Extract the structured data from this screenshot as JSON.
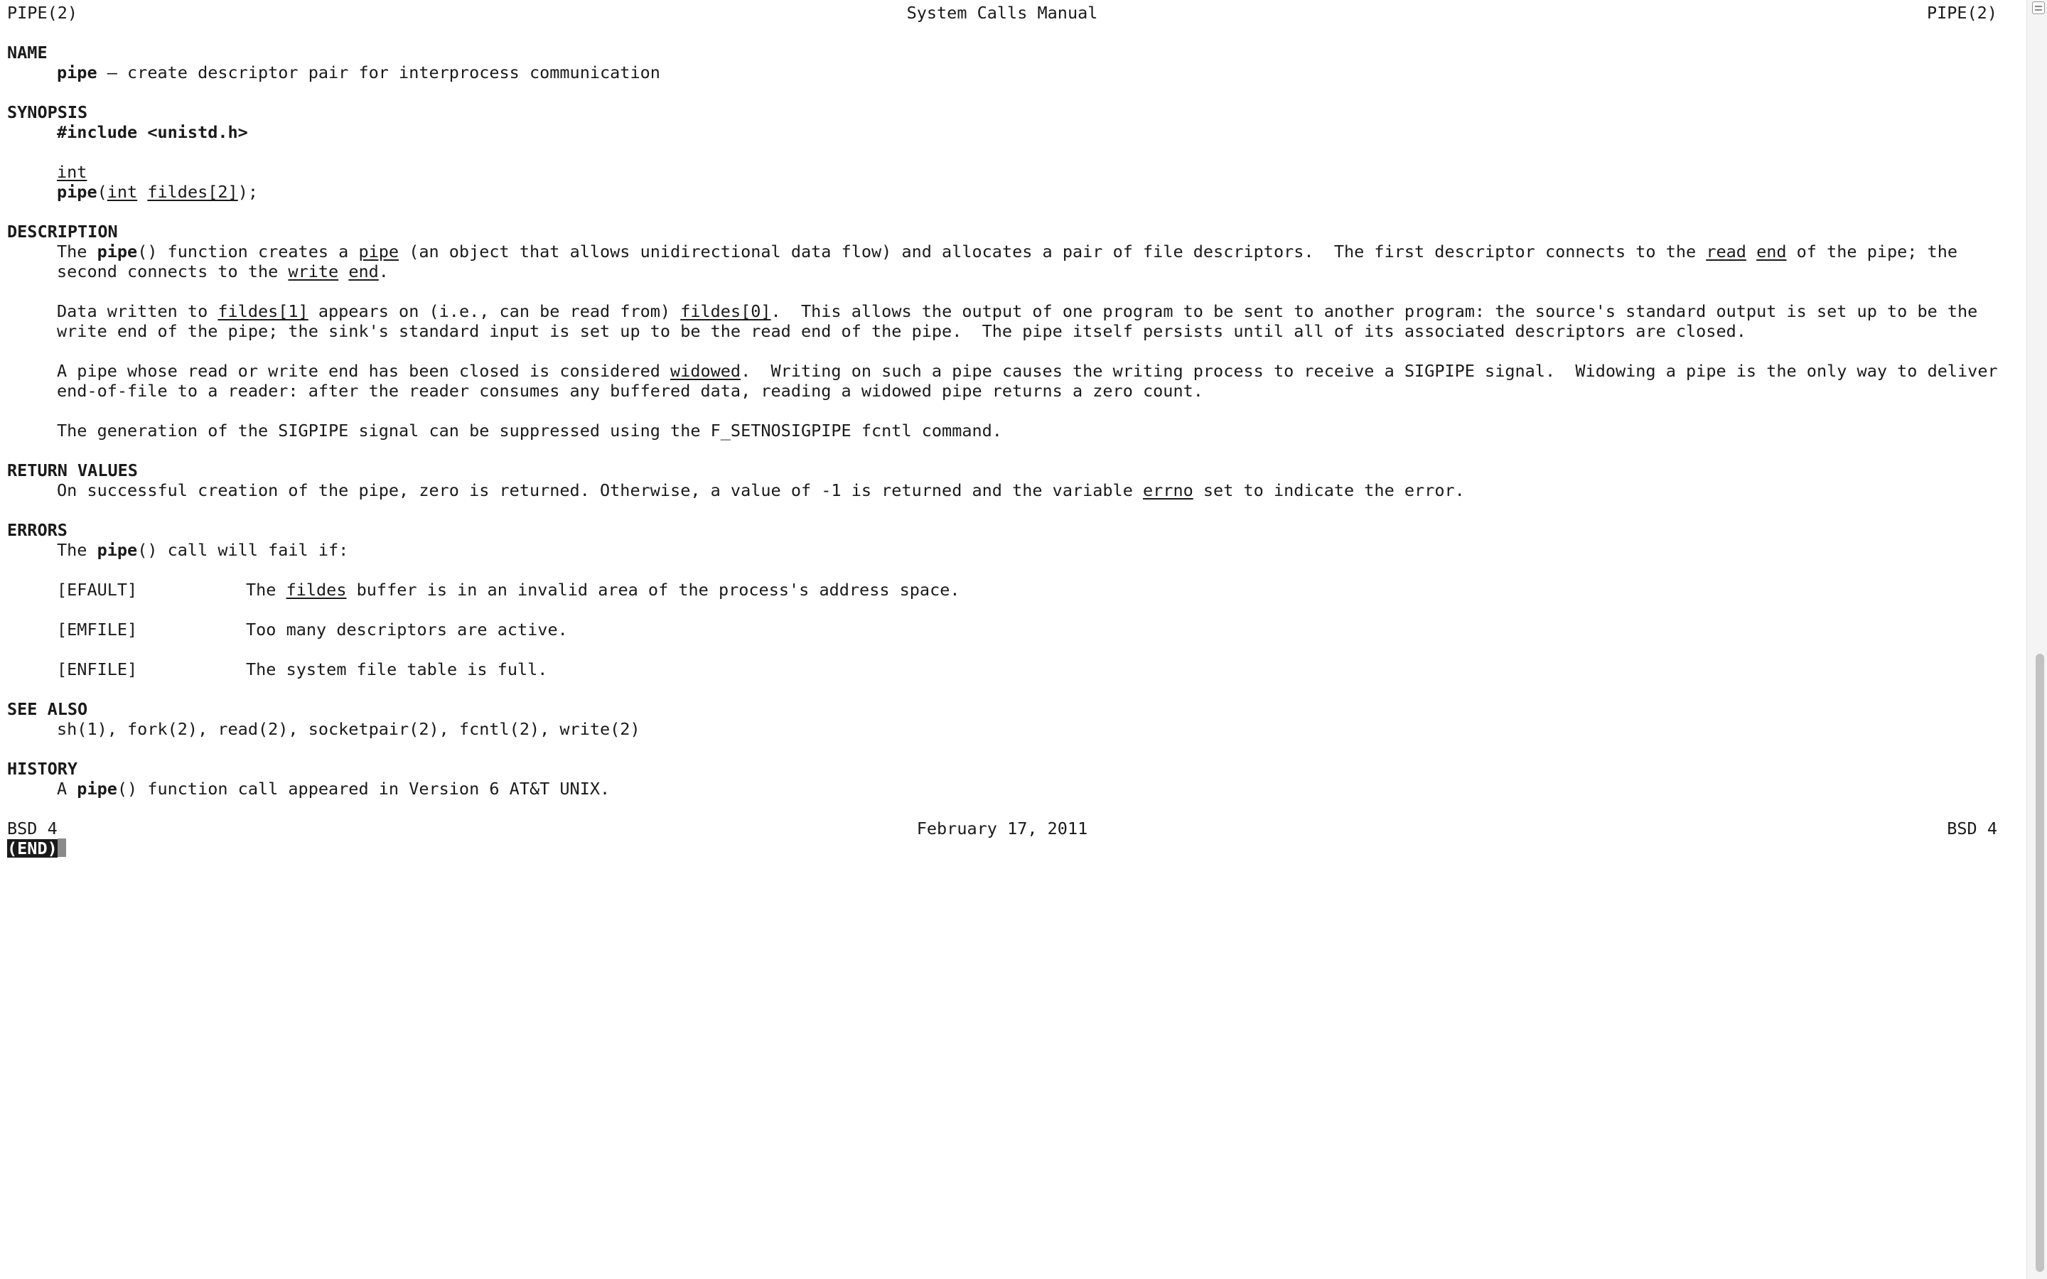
{
  "header": {
    "left": "PIPE(2)",
    "center": "System Calls Manual",
    "right": "PIPE(2)"
  },
  "name": {
    "heading": "NAME",
    "cmd": "pipe",
    "desc": " – create descriptor pair for interprocess communication"
  },
  "synopsis": {
    "heading": "SYNOPSIS",
    "include": "#include <unistd.h>",
    "ret_type": "int",
    "fn": "pipe",
    "open": "(",
    "arg_type": "int",
    "arg_name": "fildes[2]",
    "close": ");"
  },
  "description": {
    "heading": "DESCRIPTION",
    "p1": {
      "a": "The ",
      "b": "pipe",
      "c": "() function creates a ",
      "d": "pipe",
      "e": " (an object that allows unidirectional data flow) and allocates a pair of file descriptors.  The first descriptor connects to the ",
      "f": "read",
      "g": " ",
      "h": "end",
      "i": " of the pipe; the",
      "l2a": "second connects to the ",
      "l2b": "write",
      "l2c": " ",
      "l2d": "end",
      "l2e": "."
    },
    "p2": {
      "a": "Data written to ",
      "b": "fildes[1]",
      "c": " appears on (i.e., can be read from) ",
      "d": "fildes[0]",
      "e": ".  This allows the output of one program to be sent to another program: the source's standard output is set up to be the",
      "l2": "write end of the pipe; the sink's standard input is set up to be the read end of the pipe.  The pipe itself persists until all of its associated descriptors are closed."
    },
    "p3": {
      "a": "A pipe whose read or write end has been closed is considered ",
      "b": "widowed",
      "c": ".  Writing on such a pipe causes the writing process to receive a SIGPIPE signal.  Widowing a pipe is the only way to deliver",
      "l2": "end-of-file to a reader: after the reader consumes any buffered data, reading a widowed pipe returns a zero count."
    },
    "p4": "The generation of the SIGPIPE signal can be suppressed using the F_SETNOSIGPIPE fcntl command."
  },
  "return_values": {
    "heading": "RETURN VALUES",
    "a": "On successful creation of the pipe, zero is returned. Otherwise, a value of -1 is returned and the variable ",
    "b": "errno",
    "c": " set to indicate the error."
  },
  "errors": {
    "heading": "ERRORS",
    "intro_a": "The ",
    "intro_b": "pipe",
    "intro_c": "() call will fail if:",
    "e1_tag": "[EFAULT]",
    "e1_a": "The ",
    "e1_b": "fildes",
    "e1_c": " buffer is in an invalid area of the process's address space.",
    "e2_tag": "[EMFILE]",
    "e2_text": "Too many descriptors are active.",
    "e3_tag": "[ENFILE]",
    "e3_text": "The system file table is full."
  },
  "see_also": {
    "heading": "SEE ALSO",
    "text": "sh(1), fork(2), read(2), socketpair(2), fcntl(2), write(2)"
  },
  "history": {
    "heading": "HISTORY",
    "a": "A ",
    "b": "pipe",
    "c": "() function call appeared in Version 6 AT&T UNIX."
  },
  "footer": {
    "left": "BSD 4",
    "center": "February 17, 2011",
    "right": "BSD 4"
  },
  "prompt": {
    "end": "(END)"
  }
}
